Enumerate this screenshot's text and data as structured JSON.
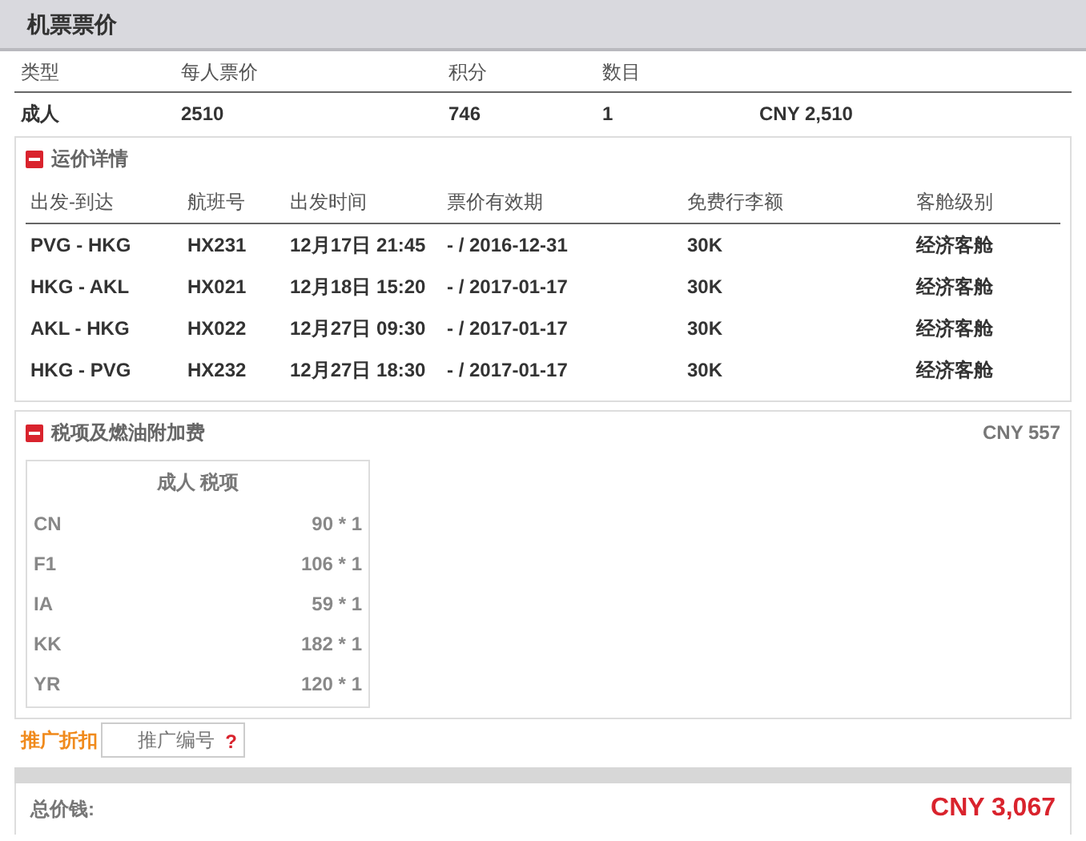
{
  "header": {
    "title": "机票票价"
  },
  "summary": {
    "columns": [
      "类型",
      "每人票价",
      "积分",
      "数目"
    ],
    "row": {
      "type": "成人",
      "price": "2510",
      "points": "746",
      "count": "1",
      "total": "CNY 2,510"
    }
  },
  "fare_details": {
    "title": "运价详情",
    "expanded": true,
    "columns": [
      "出发-到达",
      "航班号",
      "出发时间",
      "票价有效期",
      "免费行李额",
      "客舱级别"
    ],
    "rows": [
      {
        "route": "PVG - HKG",
        "flight": "HX231",
        "departure": "12月17日 21:45",
        "validity": "- / 2016-12-31",
        "baggage": "30K",
        "cabin": "经济客舱"
      },
      {
        "route": "HKG - AKL",
        "flight": "HX021",
        "departure": "12月18日 15:20",
        "validity": "- / 2017-01-17",
        "baggage": "30K",
        "cabin": "经济客舱"
      },
      {
        "route": "AKL - HKG",
        "flight": "HX022",
        "departure": "12月27日 09:30",
        "validity": "- / 2017-01-17",
        "baggage": "30K",
        "cabin": "经济客舱"
      },
      {
        "route": "HKG - PVG",
        "flight": "HX232",
        "departure": "12月27日 18:30",
        "validity": "- / 2017-01-17",
        "baggage": "30K",
        "cabin": "经济客舱"
      }
    ]
  },
  "taxes": {
    "title": "税项及燃油附加费",
    "expanded": true,
    "amount": "CNY 557",
    "table_title": "成人 税项",
    "rows": [
      {
        "code": "CN",
        "amount": "90 * 1"
      },
      {
        "code": "F1",
        "amount": "106 * 1"
      },
      {
        "code": "IA",
        "amount": "59 * 1"
      },
      {
        "code": "KK",
        "amount": "182 * 1"
      },
      {
        "code": "YR",
        "amount": "120 * 1"
      }
    ]
  },
  "promo": {
    "label": "推广折扣",
    "placeholder": "推广编号",
    "help": "?"
  },
  "total": {
    "label": "总价钱:",
    "amount": "CNY 3,067"
  }
}
